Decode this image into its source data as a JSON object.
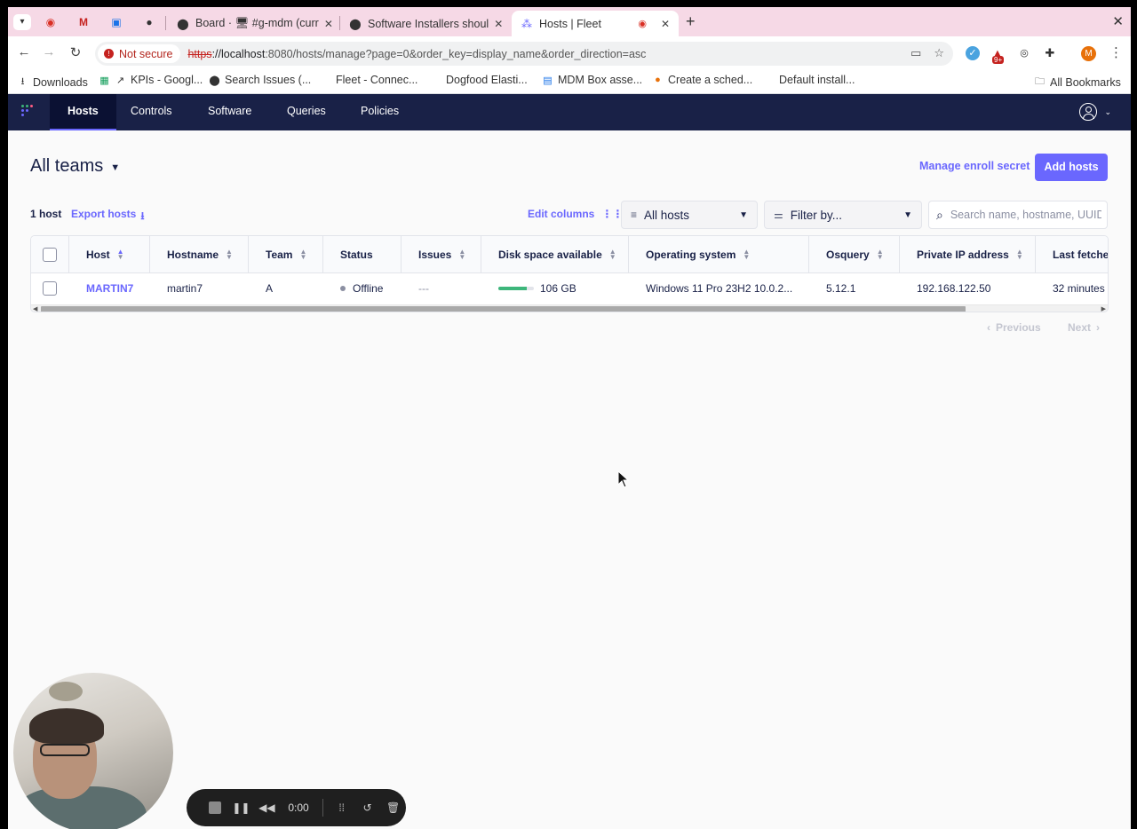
{
  "browser": {
    "tabs": [
      {
        "title": "Board · 🖥 #g-mdm (curr"
      },
      {
        "title": "Software Installers shoul"
      },
      {
        "title": "Hosts | Fleet"
      }
    ],
    "security_label": "Not secure",
    "url_scheme": "https",
    "url_host": "://localhost",
    "url_rest": ":8080/hosts/manage?page=0&order_key=display_name&order_direction=asc",
    "profile_initial": "M",
    "extension_badge": "9+",
    "bookmarks": [
      {
        "label": "Downloads"
      },
      {
        "label": "KPIs - Googl..."
      },
      {
        "label": "Search Issues (..."
      },
      {
        "label": "Fleet - Connec..."
      },
      {
        "label": "Dogfood Elasti..."
      },
      {
        "label": "MDM Box asse..."
      },
      {
        "label": "Create a sched..."
      },
      {
        "label": "Default install..."
      }
    ],
    "all_bookmarks": "All Bookmarks"
  },
  "nav": {
    "items": [
      {
        "label": "Hosts"
      },
      {
        "label": "Controls"
      },
      {
        "label": "Software"
      },
      {
        "label": "Queries"
      },
      {
        "label": "Policies"
      }
    ]
  },
  "page": {
    "team_selector": "All teams",
    "manage_enroll_secret": "Manage enroll secret",
    "add_hosts": "Add hosts",
    "host_count": "1 host",
    "export_hosts": "Export hosts",
    "edit_columns": "Edit columns",
    "status_filter": "All hosts",
    "filter_by": "Filter by...",
    "search_placeholder": "Search name, hostname, UUID, serial number, or IP address"
  },
  "table": {
    "columns": [
      "Host",
      "Hostname",
      "Team",
      "Status",
      "Issues",
      "Disk space available",
      "Operating system",
      "Osquery",
      "Private IP address",
      "Last fetched"
    ],
    "rows": [
      {
        "host": "MARTIN7",
        "hostname": "martin7",
        "team": "A",
        "status": "Offline",
        "issues": "---",
        "disk_space": "106 GB",
        "disk_fill_fraction": 0.8,
        "os": "Windows 11 Pro 23H2 10.0.2...",
        "osquery": "5.12.1",
        "private_ip": "192.168.122.50",
        "last_fetched": "32 minutes"
      }
    ]
  },
  "pagination": {
    "previous": "Previous",
    "next": "Next"
  },
  "recorder": {
    "time": "0:00"
  },
  "colors": {
    "nav_bg": "#192147",
    "accent": "#6a67fe",
    "disk_ok": "#3db67b"
  }
}
